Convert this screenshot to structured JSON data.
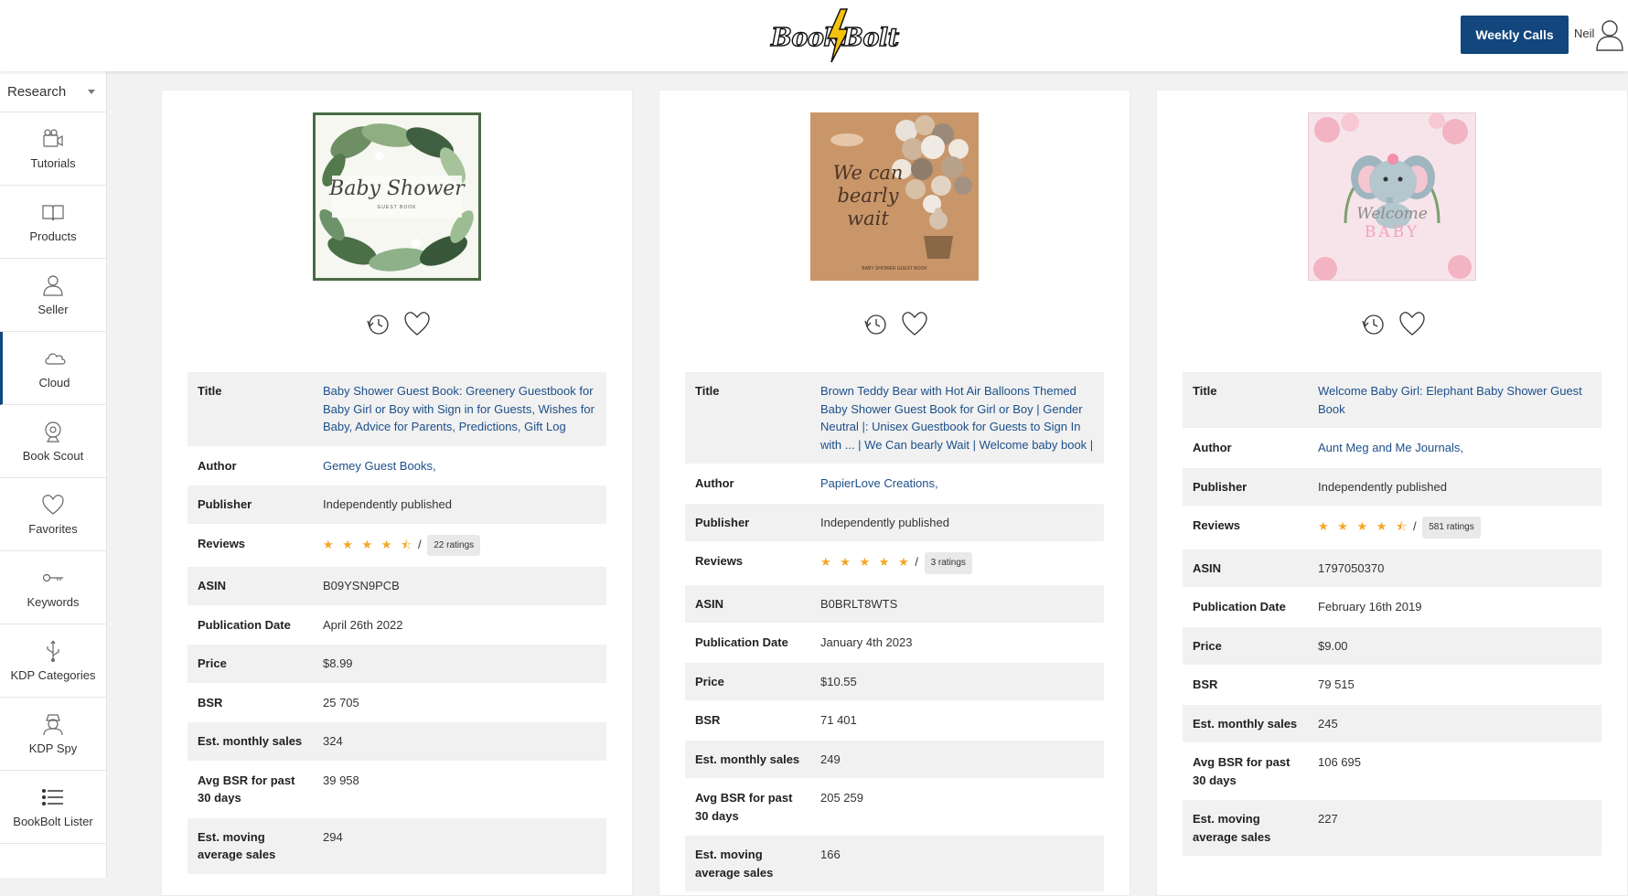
{
  "header": {
    "logo_left": "Book",
    "logo_right": "Bolt",
    "weekly_calls_label": "Weekly Calls",
    "user_name": "Neil"
  },
  "sidebar": {
    "research_label": "Research",
    "items": [
      {
        "label": "Tutorials",
        "icon": "video-camera-icon"
      },
      {
        "label": "Products",
        "icon": "book-icon"
      },
      {
        "label": "Seller",
        "icon": "person-icon"
      },
      {
        "label": "Cloud",
        "icon": "cloud-icon"
      },
      {
        "label": "Book Scout",
        "icon": "webcam-icon"
      },
      {
        "label": "Favorites",
        "icon": "heart-icon"
      },
      {
        "label": "Keywords",
        "icon": "key-icon"
      },
      {
        "label": "KDP Categories",
        "icon": "usb-icon"
      },
      {
        "label": "KDP Spy",
        "icon": "spy-icon"
      },
      {
        "label": "BookBolt Lister",
        "icon": "list-icon"
      }
    ]
  },
  "labels": {
    "title": "Title",
    "author": "Author",
    "publisher": "Publisher",
    "reviews": "Reviews",
    "asin": "ASIN",
    "publication_date": "Publication Date",
    "price": "Price",
    "bsr": "BSR",
    "monthly_sales": "Est. monthly sales",
    "avg_bsr": "Avg BSR for past 30 days",
    "moving_avg": "Est. moving average sales"
  },
  "books": [
    {
      "cover_text": "Baby Shower",
      "cover_subtext": "GUEST BOOK",
      "title": "Baby Shower Guest Book: Greenery Guestbook for Baby Girl or Boy with Sign in for Guests, Wishes for Baby, Advice for Parents, Predictions, Gift Log",
      "author": "Gemey Guest Books,",
      "publisher": "Independently published",
      "stars": "★ ★ ★ ★ ⯪",
      "ratings_count": "22 ratings",
      "asin": "B09YSN9PCB",
      "publication_date": "April 26th 2022",
      "price": "$8.99",
      "bsr": "25 705",
      "monthly_sales": "324",
      "avg_bsr": "39 958",
      "moving_avg": "294"
    },
    {
      "cover_text": "We can bearly wait",
      "cover_subtext": "BABY SHOWER GUEST BOOK",
      "title": "Brown Teddy Bear with Hot Air Balloons Themed Baby Shower Guest Book for Girl or Boy | Gender Neutral |: Unisex Guestbook for Guests to Sign In with ... | We Can bearly Wait | Welcome baby book |",
      "author": "PapierLove Creations,",
      "publisher": "Independently published",
      "stars": "★ ★ ★ ★ ★",
      "ratings_count": "3 ratings",
      "asin": "B0BRLT8WTS",
      "publication_date": "January 4th 2023",
      "price": "$10.55",
      "bsr": "71 401",
      "monthly_sales": "249",
      "avg_bsr": "205 259",
      "moving_avg": "166"
    },
    {
      "cover_text": "Welcome",
      "cover_subtext": "BABY",
      "title": "Welcome Baby Girl: Elephant Baby Shower Guest Book",
      "author": "Aunt Meg and Me Journals,",
      "publisher": "Independently published",
      "stars": "★ ★ ★ ★ ⯪",
      "ratings_count": "581 ratings",
      "asin": "1797050370",
      "publication_date": "February 16th 2019",
      "price": "$9.00",
      "bsr": "79 515",
      "monthly_sales": "245",
      "avg_bsr": "106 695",
      "moving_avg": "227"
    }
  ]
}
